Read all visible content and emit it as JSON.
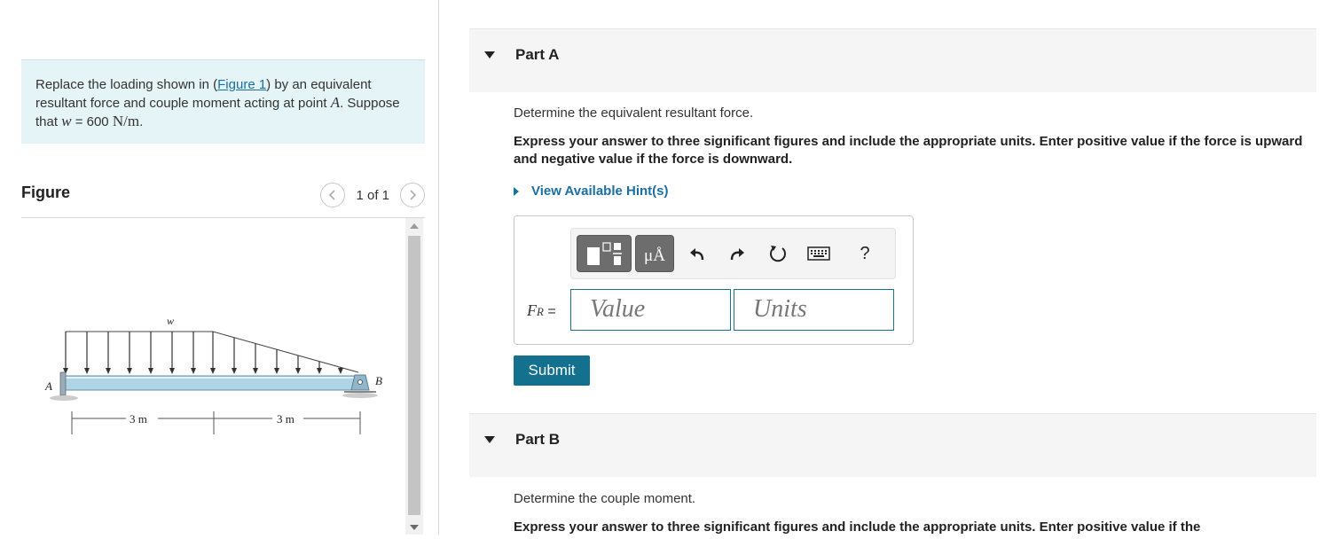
{
  "problem": {
    "text_before_link": "Replace the loading shown in (",
    "link_text": "Figure 1",
    "text_after_link": ") by an equivalent resultant force and couple moment acting at point ",
    "point": "A",
    "text_suppose": ". Suppose that ",
    "w_symbol": "w",
    "w_equals": " = 600 ",
    "w_unit": "N/m",
    "period": "."
  },
  "figure": {
    "title": "Figure",
    "pager": "1 of 1",
    "prev_icon": "chevron-left-icon",
    "next_icon": "chevron-right-icon",
    "labels": {
      "w": "w",
      "A": "A",
      "B": "B",
      "dim1": "3 m",
      "dim2": "3 m"
    }
  },
  "partA": {
    "title": "Part A",
    "question": "Determine the equivalent resultant force.",
    "instructions": "Express your answer to three significant figures and include the appropriate units. Enter positive value if the force is upward and negative value if the force is downward.",
    "hint": "View Available Hint(s)",
    "toolbar": {
      "templates_icon": "templates-icon",
      "units_button": "μÅ",
      "undo_icon": "undo-icon",
      "redo_icon": "redo-icon",
      "reset_icon": "reset-icon",
      "keyboard_icon": "keyboard-icon",
      "help": "?"
    },
    "label_symbol": "F",
    "label_sub": "R",
    "label_eq": " =",
    "value_placeholder": "Value",
    "units_placeholder": "Units",
    "submit": "Submit"
  },
  "partB": {
    "title": "Part B",
    "question": "Determine the couple moment.",
    "instructions": "Express your answer to three significant figures and include the appropriate units. Enter positive value if the"
  },
  "colors": {
    "accent": "#13708f",
    "link": "#1a6fa3",
    "beam": "#aed4e6",
    "problem_bg": "#e5f4f6"
  }
}
